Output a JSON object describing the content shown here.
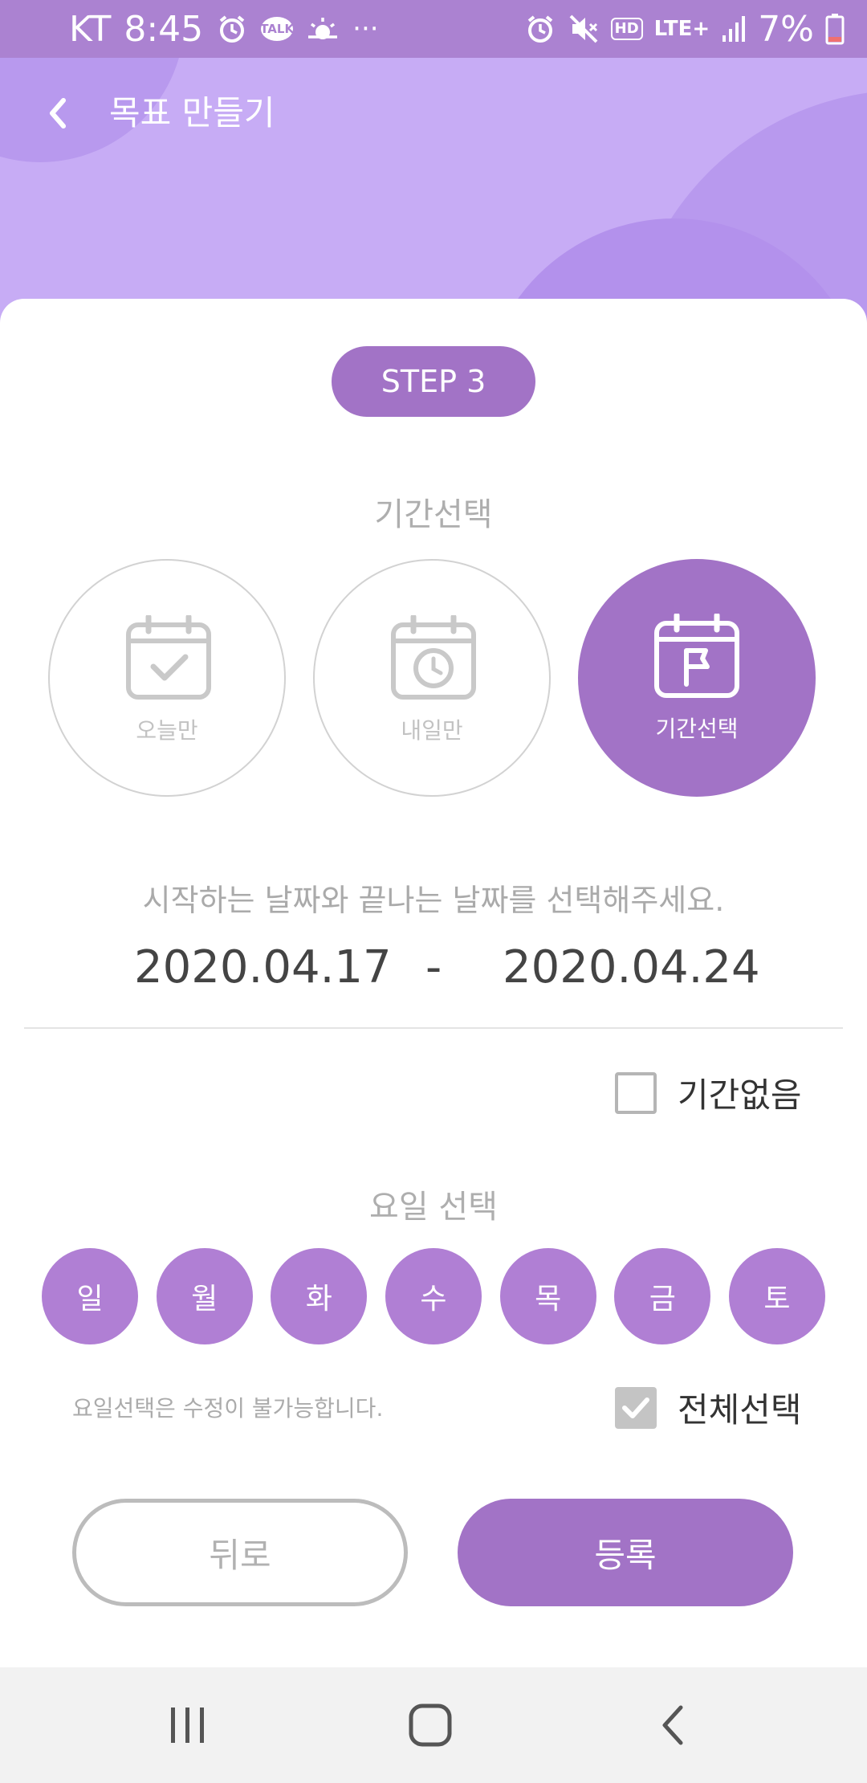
{
  "status_bar": {
    "carrier": "KT",
    "time": "8:45",
    "talk_label": "TALK",
    "more": "···",
    "hd": "HD",
    "network": "LTE+",
    "battery": "7%",
    "icons_left": [
      "alarm-icon",
      "kakaotalk-icon",
      "weather-icon",
      "more-dots-icon"
    ],
    "icons_right": [
      "alarm-icon",
      "mute-icon",
      "hd-icon",
      "lte-icon",
      "signal-icon",
      "battery-icon"
    ]
  },
  "header": {
    "title": "목표 만들기",
    "back_icon": "chevron-left-icon"
  },
  "step": {
    "label": "STEP 3"
  },
  "period": {
    "title": "기간선택",
    "options": [
      {
        "label": "오늘만",
        "icon": "calendar-check-icon",
        "selected": false
      },
      {
        "label": "내일만",
        "icon": "calendar-clock-icon",
        "selected": false
      },
      {
        "label": "기간선택",
        "icon": "calendar-flag-icon",
        "selected": true
      }
    ]
  },
  "date_range": {
    "hint": "시작하는 날짜와 끝나는 날짜를 선택해주세요.",
    "start": "2020.04.17",
    "separator": "-",
    "end": "2020.04.24"
  },
  "no_period": {
    "label": "기간없음",
    "checked": false
  },
  "weekdays": {
    "title": "요일 선택",
    "days": [
      "일",
      "월",
      "화",
      "수",
      "목",
      "금",
      "토"
    ],
    "note": "요일선택은 수정이 불가능합니다.",
    "select_all": {
      "label": "전체선택",
      "checked": true
    }
  },
  "buttons": {
    "back": "뒤로",
    "register": "등록"
  },
  "colors": {
    "accent": "#a273c6",
    "day_circle": "#b07fd4",
    "header_bg": "#c7acf5",
    "status_bar": "#ab82d1"
  },
  "nav": [
    "recent-apps-icon",
    "home-icon",
    "back-icon"
  ]
}
